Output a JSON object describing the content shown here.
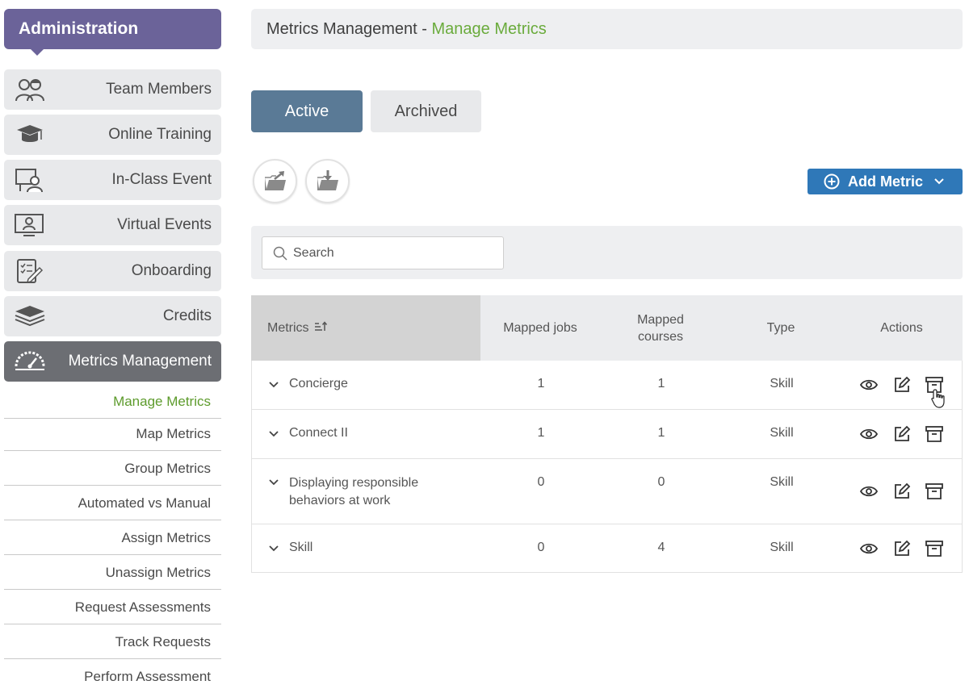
{
  "sidebar": {
    "title": "Administration",
    "items": [
      {
        "label": "Team Members",
        "icon": "team-members-icon"
      },
      {
        "label": "Online Training",
        "icon": "graduation-cap-icon"
      },
      {
        "label": "In-Class Event",
        "icon": "presenter-icon"
      },
      {
        "label": "Virtual Events",
        "icon": "monitor-person-icon"
      },
      {
        "label": "Onboarding",
        "icon": "checklist-icon"
      },
      {
        "label": "Credits",
        "icon": "layers-icon"
      },
      {
        "label": "Metrics Management",
        "icon": "gauge-icon",
        "active": true
      }
    ],
    "subitems": [
      {
        "label": "Manage Metrics",
        "current": true
      },
      {
        "label": "Map Metrics"
      },
      {
        "label": "Group Metrics"
      },
      {
        "label": "Automated vs Manual"
      },
      {
        "label": "Assign Metrics"
      },
      {
        "label": "Unassign Metrics"
      },
      {
        "label": "Request Assessments"
      },
      {
        "label": "Track Requests"
      },
      {
        "label": "Perform Assessment"
      }
    ]
  },
  "breadcrumb": {
    "parent": "Metrics Management - ",
    "current": "Manage Metrics"
  },
  "tabs": {
    "active": "Active",
    "archived": "Archived"
  },
  "toolbar": {
    "export_icon": "folder-export-icon",
    "import_icon": "folder-import-icon",
    "add_label": "Add Metric"
  },
  "search": {
    "placeholder": "Search"
  },
  "table": {
    "headers": {
      "metrics": "Metrics",
      "mapped_jobs": "Mapped jobs",
      "mapped_courses_line1": "Mapped",
      "mapped_courses_line2": "courses",
      "type": "Type",
      "actions": "Actions"
    },
    "rows": [
      {
        "name_line1": "Concierge",
        "name_line2": "",
        "mapped_jobs": "1",
        "mapped_courses": "1",
        "type": "Skill"
      },
      {
        "name_line1": "Connect II",
        "name_line2": "",
        "mapped_jobs": "1",
        "mapped_courses": "1",
        "type": "Skill"
      },
      {
        "name_line1": "Displaying responsible",
        "name_line2": "behaviors at work",
        "mapped_jobs": "0",
        "mapped_courses": "0",
        "type": "Skill"
      },
      {
        "name_line1": "Skill",
        "name_line2": "",
        "mapped_jobs": "0",
        "mapped_courses": "4",
        "type": "Skill"
      }
    ]
  },
  "colors": {
    "admin_header": "#6b6399",
    "active_nav": "#6c6e73",
    "active_tab": "#5a7a96",
    "add_button": "#2f78b8",
    "current_link": "#6aab3c"
  }
}
